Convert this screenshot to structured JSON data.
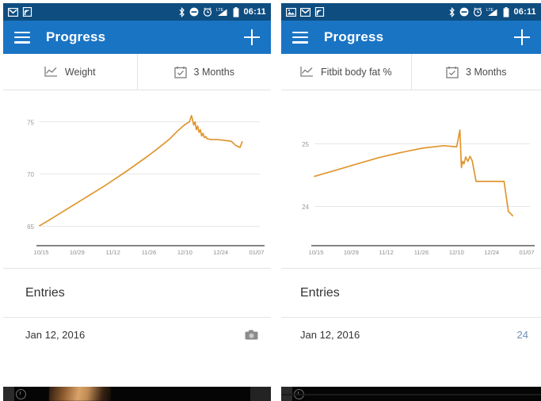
{
  "meta": {
    "accent_blue": "#1a74c4",
    "statusbar_blue": "#0e4d80",
    "line_orange": "#e8942c",
    "grid_gray": "#e6e6e6"
  },
  "panels": [
    {
      "id": "left",
      "statusbar": {
        "icons": [
          "gmail-icon",
          "rss-feed-icon"
        ],
        "right_icons": [
          "bluetooth-icon",
          "do-not-disturb-icon",
          "alarm-clock-icon",
          "signal-lte-icon",
          "battery-icon"
        ],
        "time": "06:11"
      },
      "appbar": {
        "menu_icon": "hamburger-menu-icon",
        "title": "Progress",
        "add_icon": "plus-icon"
      },
      "tabs": [
        {
          "icon": "line-chart-icon",
          "label": "Weight"
        },
        {
          "icon": "calendar-check-icon",
          "label": "3 Months"
        }
      ],
      "entries": {
        "heading": "Entries",
        "rows": [
          {
            "date": "Jan 12, 2016",
            "value": "",
            "has_photo": true
          }
        ]
      }
    },
    {
      "id": "right",
      "statusbar": {
        "icons": [
          "photo-icon",
          "gmail-icon",
          "rss-feed-icon"
        ],
        "right_icons": [
          "bluetooth-icon",
          "do-not-disturb-icon",
          "alarm-clock-icon",
          "signal-lte-icon",
          "battery-icon"
        ],
        "time": "06:11"
      },
      "appbar": {
        "menu_icon": "hamburger-menu-icon",
        "title": "Progress",
        "add_icon": "plus-icon"
      },
      "tabs": [
        {
          "icon": "line-chart-icon",
          "label": "Fitbit body fat %"
        },
        {
          "icon": "calendar-check-icon",
          "label": "3 Months"
        }
      ],
      "entries": {
        "heading": "Entries",
        "rows": [
          {
            "date": "Jan 12, 2016",
            "value": "24",
            "has_photo": false
          }
        ]
      }
    }
  ],
  "chart_data": [
    {
      "id": "weight-chart",
      "type": "line",
      "title": "Weight",
      "xlabel": "",
      "ylabel": "",
      "grid": true,
      "legend": false,
      "yticks": [
        75,
        70,
        65
      ],
      "ylim": [
        64.2,
        76.2
      ],
      "xticks": [
        "10/15",
        "10/29",
        "11/12",
        "11/26",
        "12/10",
        "12/24",
        "01/07"
      ],
      "xlim": [
        "10/15",
        "01/14"
      ],
      "series": [
        {
          "name": "Weight",
          "color": "#e0962f",
          "x": [
            0,
            4,
            9,
            14,
            19,
            24,
            29,
            34,
            39,
            44,
            49,
            54,
            59,
            63,
            66,
            68,
            69,
            70,
            70.6,
            71.2,
            71.8,
            72.4,
            73,
            73.6,
            74.2,
            74.8,
            75.4,
            76,
            77,
            78,
            79.5,
            81,
            83,
            85,
            87,
            89,
            91,
            92
          ],
          "y": [
            65.05,
            65.55,
            66.2,
            66.85,
            67.5,
            68.15,
            68.8,
            69.5,
            70.2,
            70.95,
            71.7,
            72.5,
            73.35,
            74.2,
            74.75,
            75.0,
            75.6,
            74.7,
            75.0,
            74.25,
            74.6,
            74.0,
            74.25,
            73.65,
            73.9,
            73.5,
            73.6,
            73.4,
            73.35,
            73.3,
            73.3,
            73.3,
            73.25,
            73.2,
            73.15,
            72.75,
            72.55,
            73.1
          ]
        }
      ]
    },
    {
      "id": "bodyfat-chart",
      "type": "line",
      "title": "Fitbit body fat %",
      "xlabel": "",
      "ylabel": "",
      "grid": true,
      "legend": false,
      "yticks": [
        25,
        24
      ],
      "ylim": [
        23.55,
        25.55
      ],
      "xticks": [
        "10/15",
        "10/29",
        "11/12",
        "11/26",
        "12/10",
        "12/24",
        "01/07"
      ],
      "xlim": [
        "10/15",
        "01/14"
      ],
      "series": [
        {
          "name": "Fitbit body fat %",
          "color": "#e0962f",
          "x": [
            0,
            10,
            20,
            30,
            40,
            50,
            60,
            66,
            67.5,
            68.2,
            68.8,
            69.4,
            70.2,
            71.2,
            72.2,
            73.2,
            74.2,
            75,
            76,
            78,
            81,
            88,
            90,
            92
          ],
          "y": [
            24.48,
            24.58,
            24.68,
            24.78,
            24.86,
            24.93,
            24.97,
            24.95,
            25.22,
            24.62,
            24.72,
            24.68,
            24.79,
            24.72,
            24.8,
            24.73,
            24.55,
            24.4,
            24.4,
            24.4,
            24.4,
            24.4,
            23.92,
            23.85
          ]
        }
      ]
    }
  ]
}
